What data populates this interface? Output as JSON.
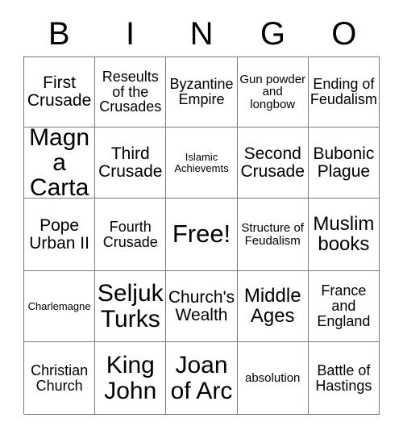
{
  "card": {
    "header_letters": [
      "B",
      "I",
      "N",
      "G",
      "O"
    ],
    "columns": 5,
    "rows": 5,
    "border_color": "#7a7a7a",
    "background_color": "#ffffff",
    "text_color": "#000000",
    "cells": [
      [
        {
          "text": "First Crusade",
          "size": "lg"
        },
        {
          "text": "Reseults of the Crusades",
          "size": "md"
        },
        {
          "text": "Byzantine Empire",
          "size": "md"
        },
        {
          "text": "Gun powder and longbow",
          "size": "sm"
        },
        {
          "text": "Ending of Feudalism",
          "size": "md"
        }
      ],
      [
        {
          "text": "Magna Carta",
          "size": "xxl"
        },
        {
          "text": "Third Crusade",
          "size": "lg"
        },
        {
          "text": "Islamic Achievemts",
          "size": "xs"
        },
        {
          "text": "Second Crusade",
          "size": "lg"
        },
        {
          "text": "Bubonic Plague",
          "size": "lg"
        }
      ],
      [
        {
          "text": "Pope Urban II",
          "size": "lg"
        },
        {
          "text": "Fourth Crusade",
          "size": "md"
        },
        {
          "text": "Free!",
          "size": "free"
        },
        {
          "text": "Structure of Feudalism",
          "size": "sm"
        },
        {
          "text": "Muslim books",
          "size": "xl"
        }
      ],
      [
        {
          "text": "Charlemagne",
          "size": "xs"
        },
        {
          "text": "Seljuk Turks",
          "size": "xxl"
        },
        {
          "text": "Church's Wealth",
          "size": "lg"
        },
        {
          "text": "Middle Ages",
          "size": "xl"
        },
        {
          "text": "France and England",
          "size": "md"
        }
      ],
      [
        {
          "text": "Christian Church",
          "size": "md"
        },
        {
          "text": "King John",
          "size": "xxl"
        },
        {
          "text": "Joan of Arc",
          "size": "xxl"
        },
        {
          "text": "absolution",
          "size": "sm"
        },
        {
          "text": "Battle of Hastings",
          "size": "md"
        }
      ]
    ]
  }
}
